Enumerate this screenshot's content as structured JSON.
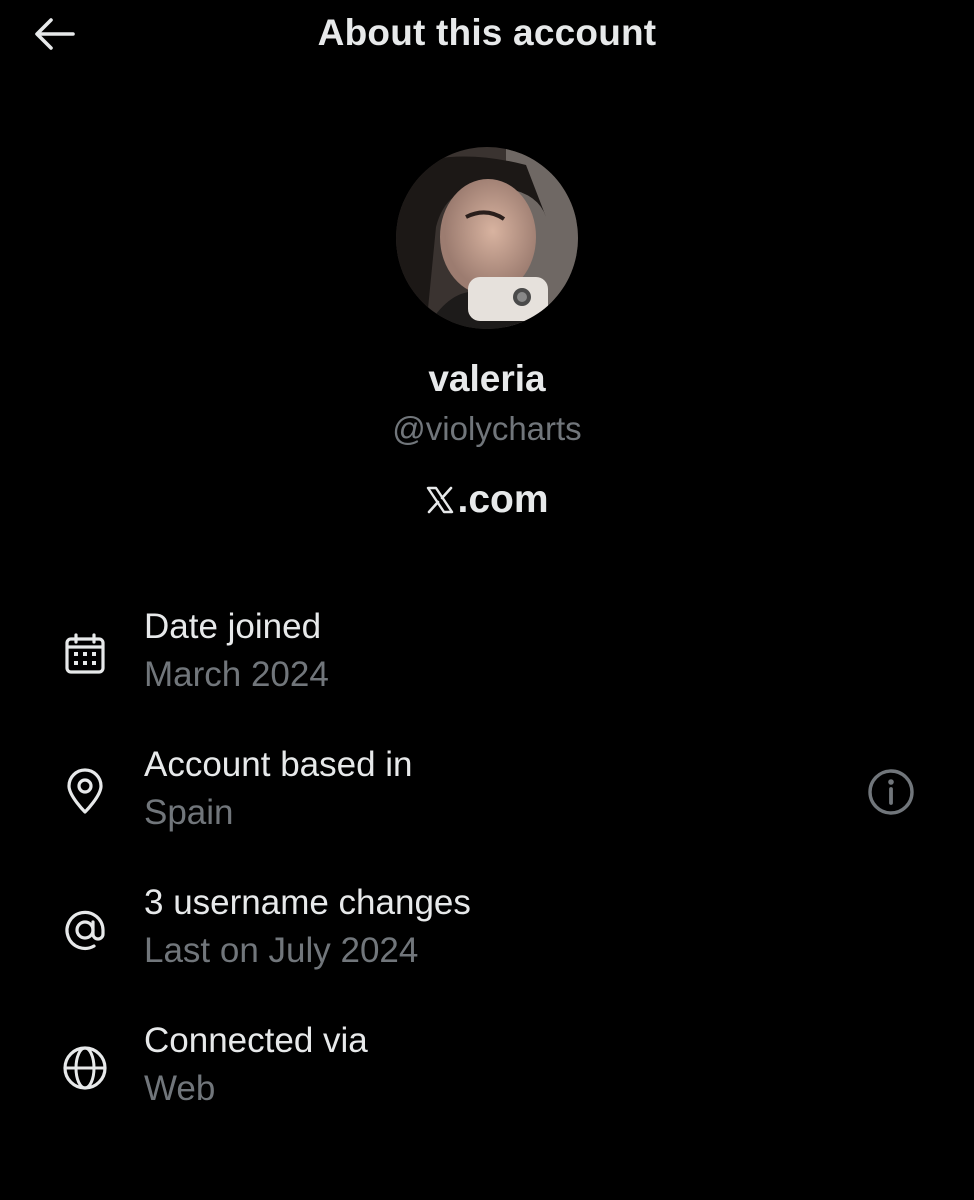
{
  "header": {
    "title": "About this account",
    "back_icon": "arrow-left-icon"
  },
  "profile": {
    "display_name": "valeria",
    "handle": "@violycharts",
    "platform_logo_icon": "x-logo-icon",
    "platform_text": ".com"
  },
  "details": [
    {
      "icon": "calendar-icon",
      "title": "Date joined",
      "value": "March 2024"
    },
    {
      "icon": "location-pin-icon",
      "title": "Account based in",
      "value": "Spain",
      "action_icon": "info-icon"
    },
    {
      "icon": "at-sign-icon",
      "title": "3 username changes",
      "value": "Last on July 2024"
    },
    {
      "icon": "globe-icon",
      "title": "Connected via",
      "value": "Web"
    }
  ],
  "colors": {
    "background": "#000000",
    "primary_text": "#e7e9ea",
    "secondary_text": "#71767b"
  }
}
